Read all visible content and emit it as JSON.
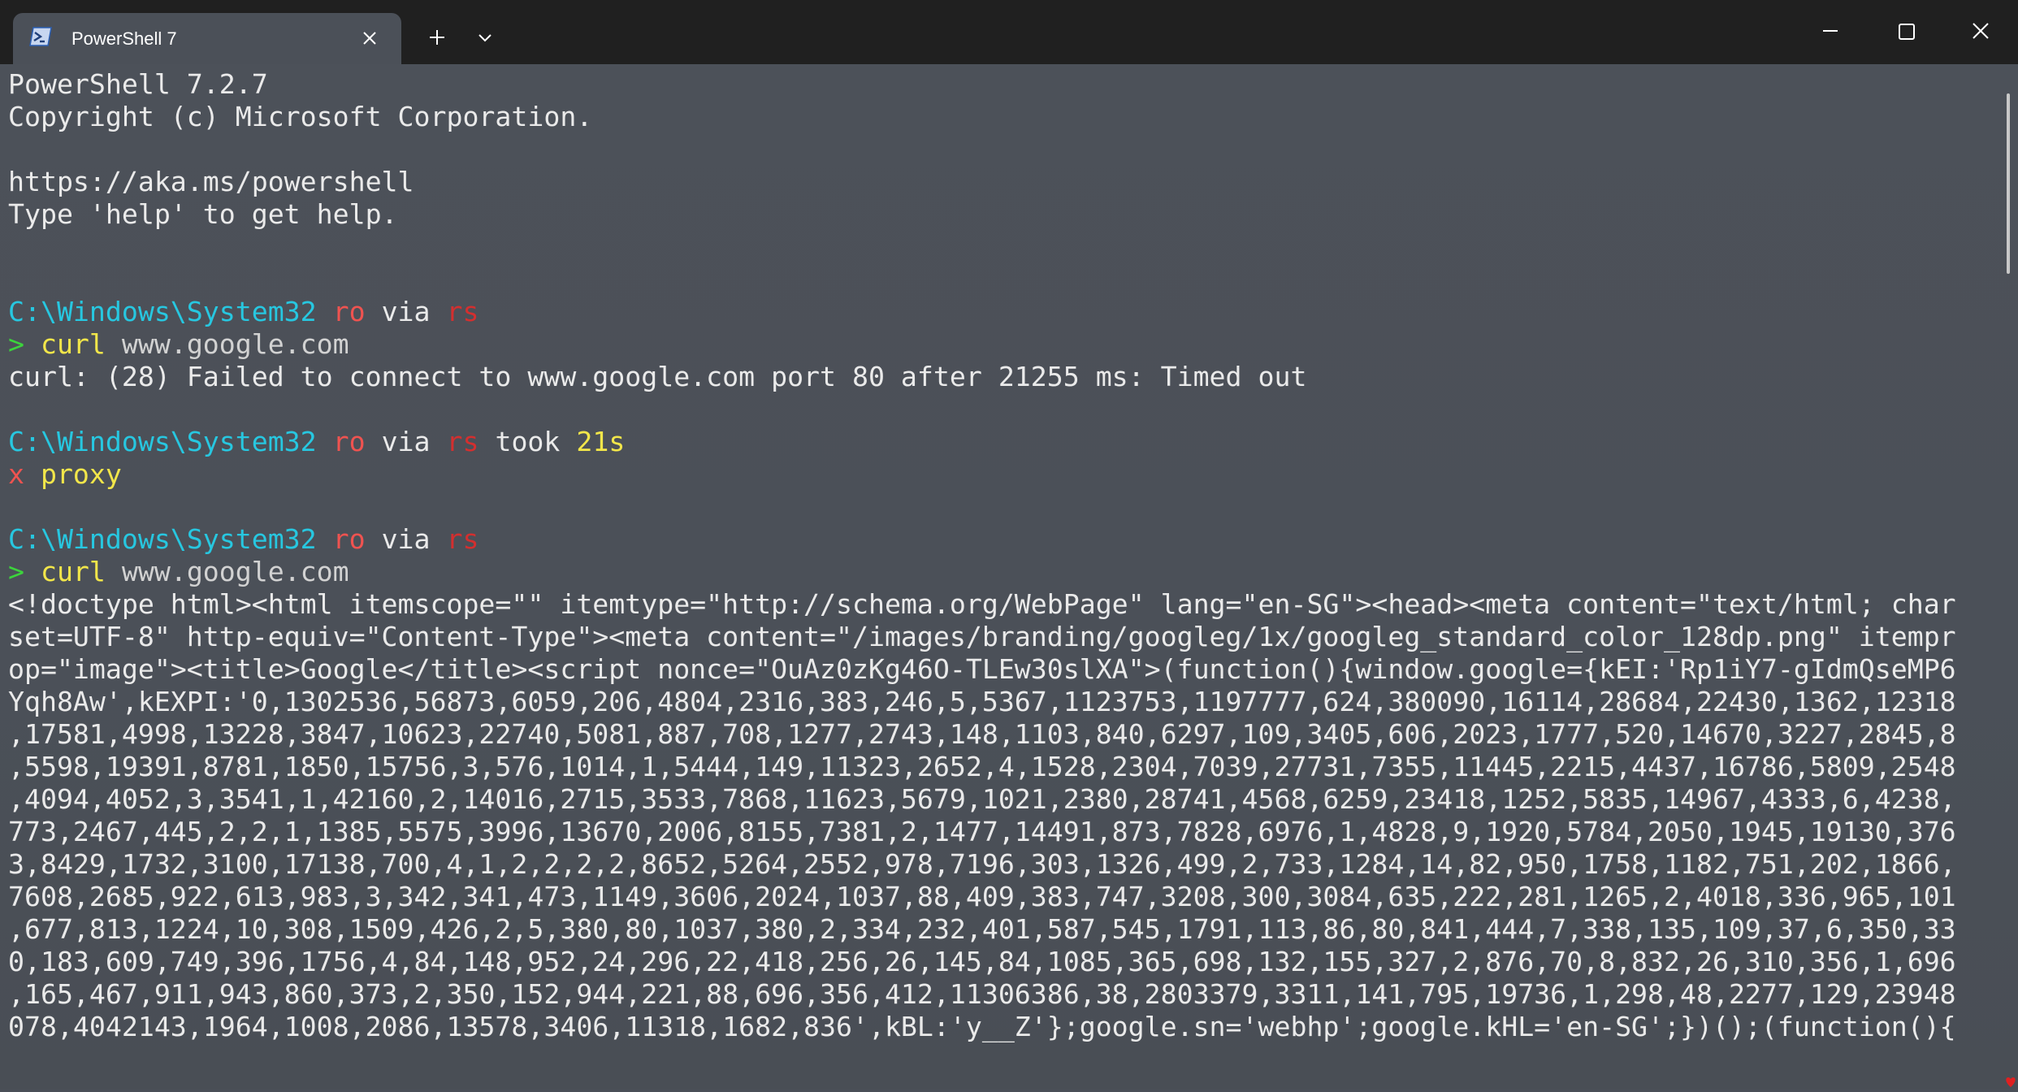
{
  "titlebar": {
    "tab_title": "PowerShell 7",
    "icons": {
      "tab_icon": "powershell-icon",
      "close": "close-icon",
      "new_tab": "plus-icon",
      "dropdown": "chevron-down-icon",
      "minimize": "minimize-icon",
      "maximize": "maximize-icon",
      "window_close": "close-icon"
    }
  },
  "colors": {
    "background": "#4b5058",
    "titlebar": "#202020",
    "path": "#27c7e0",
    "branch": "#ef5350",
    "rust": "#d32f2f",
    "duration": "#f2e64a",
    "prompt_ok": "#3cd33c",
    "prompt_err": "#ef5350",
    "command": "#f2e64a"
  },
  "banner": {
    "version": "PowerShell 7.2.7",
    "copyright": "Copyright (c) Microsoft Corporation.",
    "url": "https://aka.ms/powershell",
    "help": "Type 'help' to get help."
  },
  "prompt1": {
    "path": "C:\\Windows\\System32",
    "branch": "ro",
    "via": "via",
    "lang": "rs",
    "symbol": ">",
    "cmd": "curl",
    "arg": "www.google.com",
    "output": "curl: (28) Failed to connect to www.google.com port 80 after 21255 ms: Timed out"
  },
  "prompt2": {
    "path": "C:\\Windows\\System32",
    "branch": "ro",
    "via": "via",
    "lang": "rs",
    "took": "took",
    "duration": "21s",
    "symbol": "x",
    "cmd": "proxy"
  },
  "prompt3": {
    "path": "C:\\Windows\\System32",
    "branch": "ro",
    "via": "via",
    "lang": "rs",
    "symbol": ">",
    "cmd": "curl",
    "arg": "www.google.com"
  },
  "output_lines": [
    "<!doctype html><html itemscope=\"\" itemtype=\"http://schema.org/WebPage\" lang=\"en-SG\"><head><meta content=\"text/html; char",
    "set=UTF-8\" http-equiv=\"Content-Type\"><meta content=\"/images/branding/googleg/1x/googleg_standard_color_128dp.png\" itempr",
    "op=\"image\"><title>Google</title><script nonce=\"OuAz0zKg46O-TLEw30slXA\">(function(){window.google={kEI:'Rp1iY7-gIdmQseMP6",
    "Yqh8Aw',kEXPI:'0,1302536,56873,6059,206,4804,2316,383,246,5,5367,1123753,1197777,624,380090,16114,28684,22430,1362,12318",
    ",17581,4998,13228,3847,10623,22740,5081,887,708,1277,2743,148,1103,840,6297,109,3405,606,2023,1777,520,14670,3227,2845,8",
    ",5598,19391,8781,1850,15756,3,576,1014,1,5444,149,11323,2652,4,1528,2304,7039,27731,7355,11445,2215,4437,16786,5809,2548",
    ",4094,4052,3,3541,1,42160,2,14016,2715,3533,7868,11623,5679,1021,2380,28741,4568,6259,23418,1252,5835,14967,4333,6,4238,",
    "773,2467,445,2,2,1,1385,5575,3996,13670,2006,8155,7381,2,1477,14491,873,7828,6976,1,4828,9,1920,5784,2050,1945,19130,376",
    "3,8429,1732,3100,17138,700,4,1,2,2,2,2,8652,5264,2552,978,7196,303,1326,499,2,733,1284,14,82,950,1758,1182,751,202,1866,",
    "7608,2685,922,613,983,3,342,341,473,1149,3606,2024,1037,88,409,383,747,3208,300,3084,635,222,281,1265,2,4018,336,965,101",
    ",677,813,1224,10,308,1509,426,2,5,380,80,1037,380,2,334,232,401,587,545,1791,113,86,80,841,444,7,338,135,109,37,6,350,33",
    "0,183,609,749,396,1756,4,84,148,952,24,296,22,418,256,26,145,84,1085,365,698,132,155,327,2,876,70,8,832,26,310,356,1,696",
    ",165,467,911,943,860,373,2,350,152,944,221,88,696,356,412,11306386,38,2803379,3311,141,795,19736,1,298,48,2277,129,23948",
    "078,4042143,1964,1008,2086,13578,3406,11318,1682,836',kBL:'y__Z'};google.sn='webhp';google.kHL='en-SG';})();(function(){"
  ]
}
